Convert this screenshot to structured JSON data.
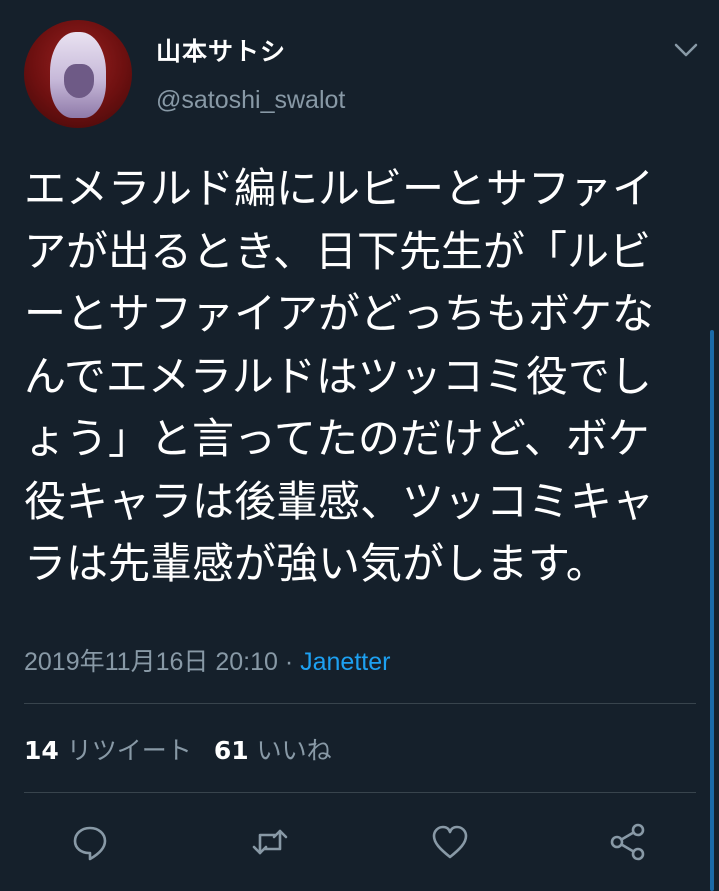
{
  "user": {
    "display_name": "山本サトシ",
    "handle": "@satoshi_swalot"
  },
  "tweet": {
    "lines": [
      "エメラルド編にルビーとサファイ",
      "アが出るとき、日下先生が「ルビ",
      "ーとサファイアがどっちもボケな",
      "んでエメラルドはツッコミ役でし",
      "ょう」と言ってたのだけど、ボケ",
      "役キャラは後輩感、ツッコミキャ",
      "ラは先輩感が強い気がします。"
    ],
    "timestamp": "2019年11月16日 20:10",
    "separator": " · ",
    "client": "Janetter"
  },
  "stats": {
    "retweets_count": "14",
    "retweets_label": "リツイート",
    "likes_count": "61",
    "likes_label": "いいね"
  },
  "icons": {
    "menu": "chevron-down-icon",
    "reply": "reply-icon",
    "retweet": "retweet-icon",
    "like": "heart-icon",
    "share": "share-icon"
  },
  "colors": {
    "background": "#15202b",
    "secondary_text": "#8899a6",
    "accent": "#1da1f2",
    "divider": "#38444d"
  }
}
